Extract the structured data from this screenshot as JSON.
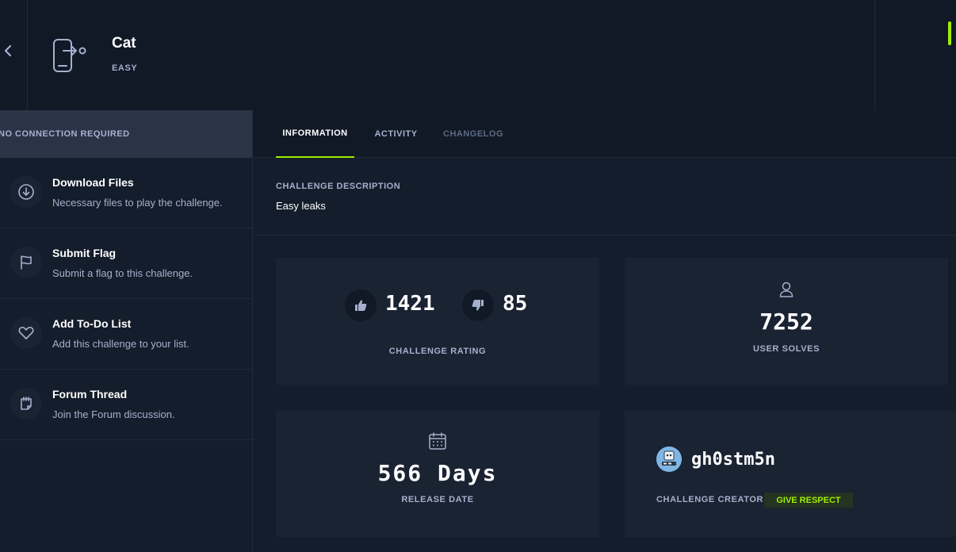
{
  "header": {
    "title": "Cat",
    "difficulty": "EASY"
  },
  "sidebar": {
    "banner": "NO CONNECTION REQUIRED",
    "items": [
      {
        "title": "Download Files",
        "desc": "Necessary files to play the challenge.",
        "icon": "download-icon"
      },
      {
        "title": "Submit Flag",
        "desc": "Submit a flag to this challenge.",
        "icon": "flag-icon"
      },
      {
        "title": "Add To-Do List",
        "desc": "Add this challenge to your list.",
        "icon": "heart-icon"
      },
      {
        "title": "Forum Thread",
        "desc": "Join the Forum discussion.",
        "icon": "forum-icon"
      }
    ]
  },
  "tabs": [
    {
      "label": "INFORMATION",
      "state": "active"
    },
    {
      "label": "ACTIVITY",
      "state": "normal"
    },
    {
      "label": "CHANGELOG",
      "state": "disabled"
    }
  ],
  "description": {
    "label": "CHALLENGE DESCRIPTION",
    "text": "Easy leaks"
  },
  "stats": {
    "rating": {
      "likes": "1421",
      "dislikes": "85",
      "label": "CHALLENGE RATING"
    },
    "solves": {
      "value": "7252",
      "label": "USER SOLVES"
    },
    "release": {
      "value": "566 Days",
      "label": "RELEASE DATE"
    },
    "creator": {
      "name": "gh0stm5n",
      "label": "CHALLENGE CREATOR",
      "button": "GIVE RESPECT"
    }
  },
  "colors": {
    "accent": "#9fef00",
    "background": "#141d2b",
    "panel": "#1a2332",
    "muted_text": "#a4b1cd"
  }
}
